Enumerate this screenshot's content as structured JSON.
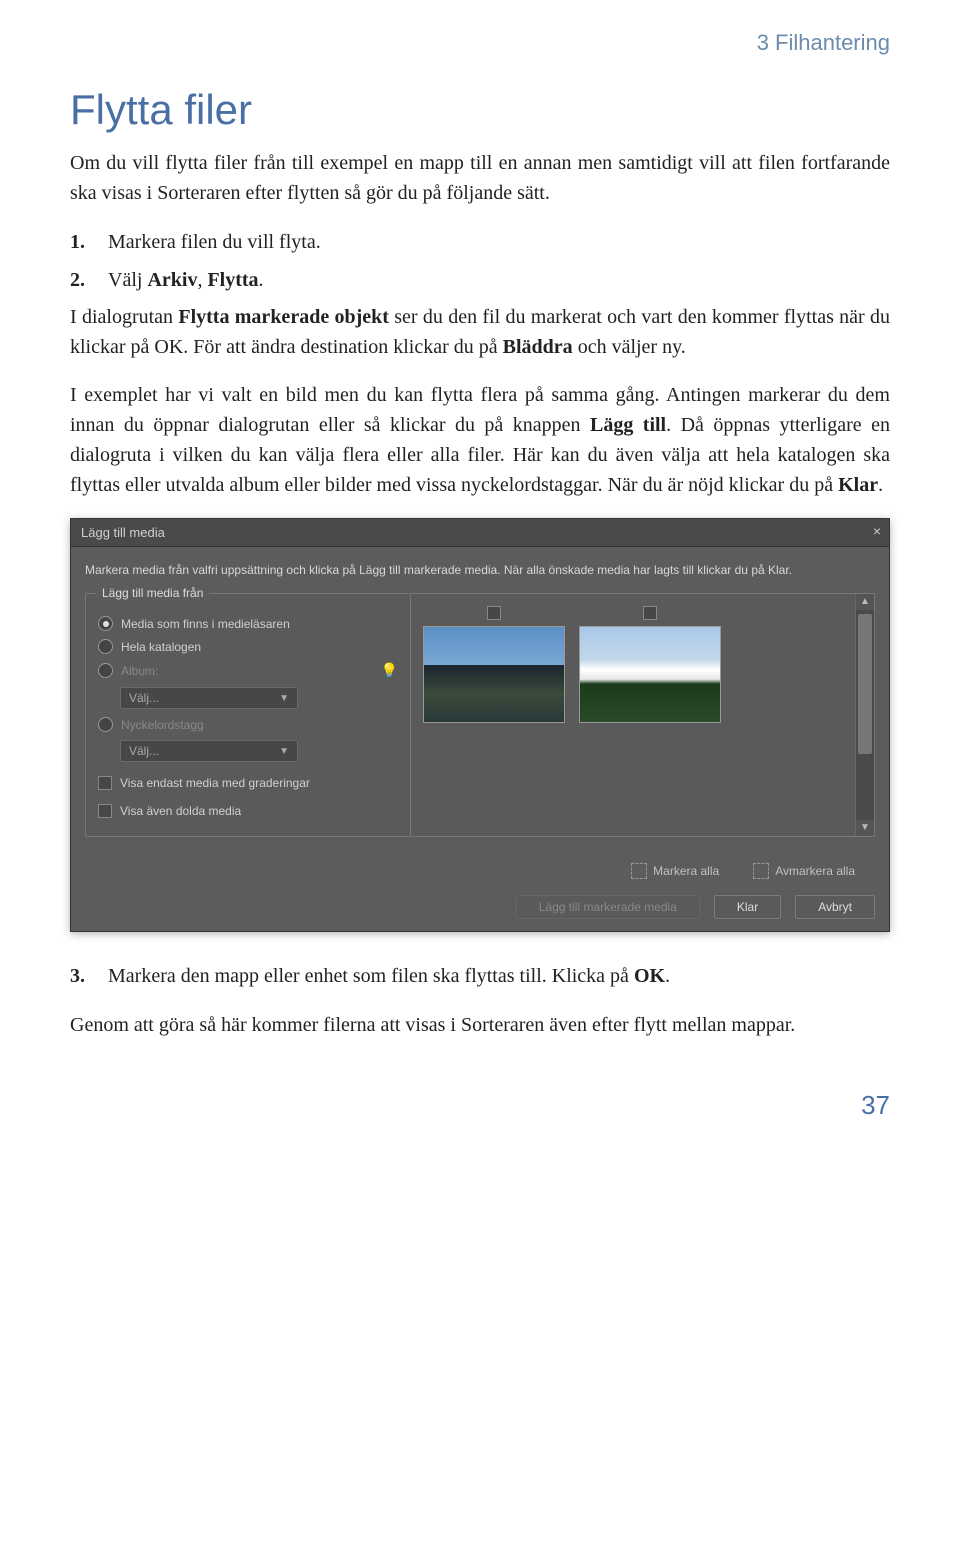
{
  "chapter": "3 Filhantering",
  "title": "Flytta filer",
  "intro": "Om du vill flytta filer från till exempel en mapp till en annan men samtidigt vill att filen fortfarande ska visas i Sorteraren efter flytten så gör du på följande sätt.",
  "step1_num": "1.",
  "step1": "Markera filen du vill flyta.",
  "step2_num": "2.",
  "step2_pre": "Välj ",
  "step2_b1": "Arkiv",
  "step2_mid": ", ",
  "step2_b2": "Flytta",
  "step2_post": ".",
  "p3a": "I dialogrutan ",
  "p3b": "Flytta markerade objekt",
  "p3c": " ser du den fil du markerat och vart den kommer flyttas när du klickar på OK. För att ändra destination klickar du på ",
  "p3d": "Bläddra",
  "p3e": " och väljer ny.",
  "p4a": "I exemplet har vi valt en bild men du kan flytta flera på samma gång. Antingen markerar du dem innan du öppnar dialogrutan eller så klickar du på knappen ",
  "p4b": "Lägg till",
  "p4c": ". Då öppnas ytterligare en dialogruta i vilken du kan välja flera eller alla filer. Här kan du även välja att hela katalogen ska flyttas eller utvalda album eller bilder med vissa nyckelordstaggar. När du är nöjd klickar du på ",
  "p4d": "Klar",
  "p4e": ".",
  "dlg": {
    "title": "Lägg till media",
    "desc": "Markera media från valfri uppsättning och klicka på Lägg till markerade media. När alla önskade media har lagts till klickar du på Klar.",
    "fieldset": "Lägg till media från",
    "r1": "Media som finns i medieläsaren",
    "r2": "Hela katalogen",
    "r3": "Album:",
    "r4": "Nyckelordstagg",
    "select": "Välj...",
    "chk1": "Visa endast media med graderingar",
    "chk2": "Visa även dolda media",
    "mark_all": "Markera alla",
    "unmark_all": "Avmarkera alla",
    "btn_add": "Lägg till markerade media",
    "btn_done": "Klar",
    "btn_cancel": "Avbryt"
  },
  "step3_num": "3.",
  "step3a": "Markera den mapp eller enhet som filen ska flyttas till. Klicka på ",
  "step3b": "OK",
  "step3c": ".",
  "outro": "Genom att göra så här kommer filerna att visas i Sorteraren även efter flytt mellan mappar.",
  "pagenum": "37"
}
